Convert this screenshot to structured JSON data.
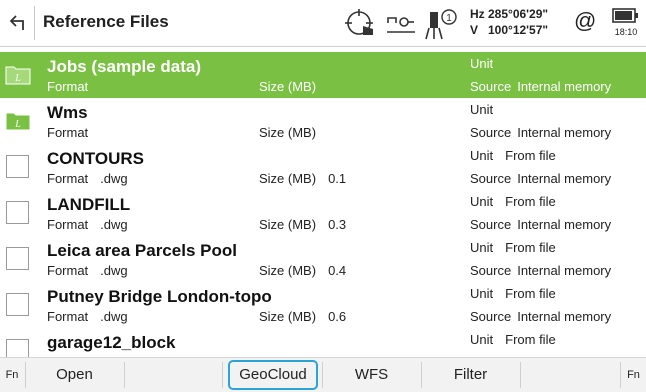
{
  "header": {
    "title": "Reference Files",
    "hz_label": "Hz",
    "hz_value": "285°06'29\"",
    "v_label": "V",
    "v_value": "100°12'57\"",
    "time": "18:10",
    "at_symbol": "@"
  },
  "labels": {
    "format": "Format",
    "size": "Size (MB)",
    "unit": "Unit",
    "source": "Source"
  },
  "rows": [
    {
      "name": "Jobs (sample data)",
      "format": "",
      "size": "",
      "unit": "",
      "source": "Internal memory",
      "type": "folder",
      "selected": true
    },
    {
      "name": "Wms",
      "format": "",
      "size": "",
      "unit": "",
      "source": "Internal memory",
      "type": "folder",
      "selected": false
    },
    {
      "name": "CONTOURS",
      "format": ".dwg",
      "size": "0.1",
      "unit": "From file",
      "source": "Internal memory",
      "type": "file",
      "selected": false
    },
    {
      "name": "LANDFILL",
      "format": ".dwg",
      "size": "0.3",
      "unit": "From file",
      "source": "Internal memory",
      "type": "file",
      "selected": false
    },
    {
      "name": "Leica area Parcels Pool",
      "format": ".dwg",
      "size": "0.4",
      "unit": "From file",
      "source": "Internal memory",
      "type": "file",
      "selected": false
    },
    {
      "name": "Putney Bridge London-topo",
      "format": ".dwg",
      "size": "0.6",
      "unit": "From file",
      "source": "Internal memory",
      "type": "file",
      "selected": false
    },
    {
      "name": "garage12_block",
      "format": "",
      "size": "",
      "unit": "From file",
      "source": "",
      "type": "file",
      "selected": false
    }
  ],
  "footer": {
    "fn_left": "Fn",
    "open": "Open",
    "geocloud": "GeoCloud",
    "wfs": "WFS",
    "filter": "Filter",
    "fn_right": "Fn"
  },
  "colors": {
    "selected_row": "#7ac143",
    "highlight_border": "#2aa3d6",
    "folder_green": "#7ac143"
  },
  "icons": {
    "back": "back-arrow-icon",
    "target": "target-hand-icon",
    "level": "level-icon",
    "instrument": "instrument-face-icon",
    "at": "at-icon",
    "battery": "battery-icon",
    "folder": "folder-icon"
  }
}
